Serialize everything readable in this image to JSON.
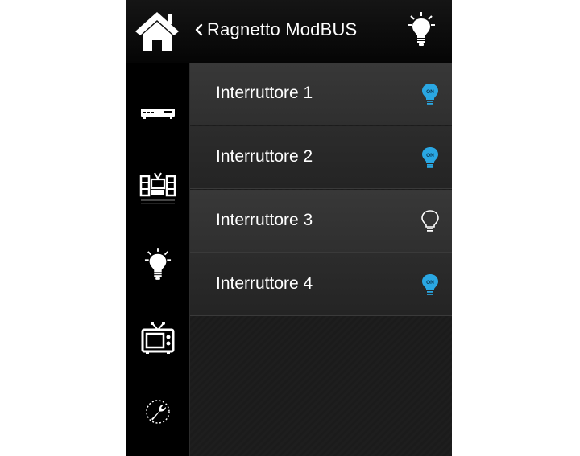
{
  "header": {
    "back_label": "Ragnetto ModBUS"
  },
  "sidebar": {
    "items": [
      {
        "icon": "stereo-receiver-icon"
      },
      {
        "icon": "media-shelf-icon"
      },
      {
        "icon": "light-bulb-icon"
      },
      {
        "icon": "tv-icon"
      },
      {
        "icon": "wrench-settings-icon"
      }
    ]
  },
  "switches": [
    {
      "label": "Interruttore 1",
      "state": "on",
      "badge": "ON"
    },
    {
      "label": "Interruttore 2",
      "state": "on",
      "badge": "ON"
    },
    {
      "label": "Interruttore 3",
      "state": "off",
      "badge": ""
    },
    {
      "label": "Interruttore 4",
      "state": "on",
      "badge": "ON"
    }
  ],
  "colors": {
    "on": "#2aa7e3",
    "off": "#ffffff"
  }
}
